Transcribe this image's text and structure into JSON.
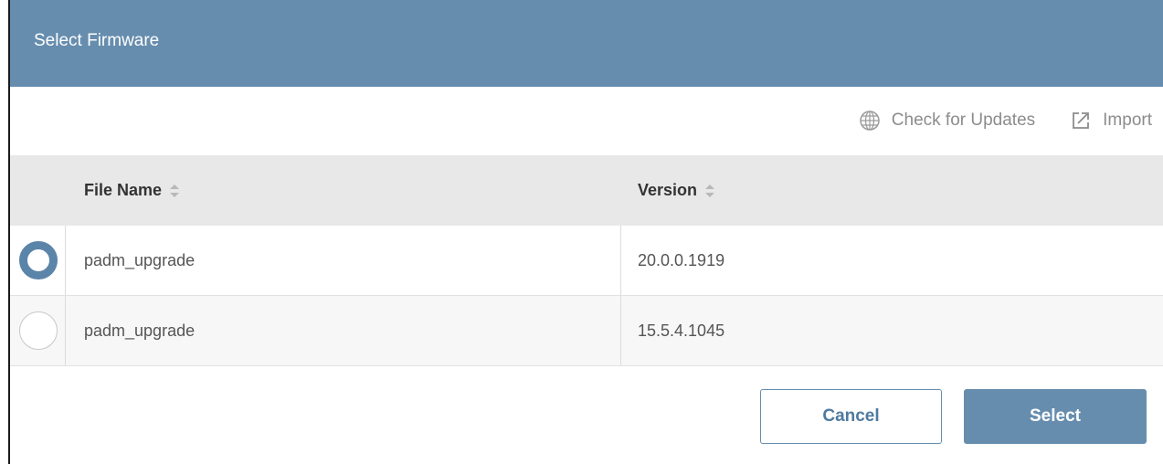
{
  "dialog": {
    "title": "Select Firmware"
  },
  "toolbar": {
    "check_updates_label": "Check for Updates",
    "import_label": "Import"
  },
  "table": {
    "columns": [
      "File Name",
      "Version"
    ],
    "rows": [
      {
        "file_name": "padm_upgrade",
        "version": "20.0.0.1919",
        "selected": true
      },
      {
        "file_name": "padm_upgrade",
        "version": "15.5.4.1045",
        "selected": false
      }
    ]
  },
  "footer": {
    "cancel_label": "Cancel",
    "select_label": "Select"
  },
  "colors": {
    "header_bg": "#668dae",
    "accent": "#5b84a9"
  },
  "icons": {
    "check_updates": "globe-icon",
    "import": "import-icon",
    "sort": "sort-icon"
  }
}
